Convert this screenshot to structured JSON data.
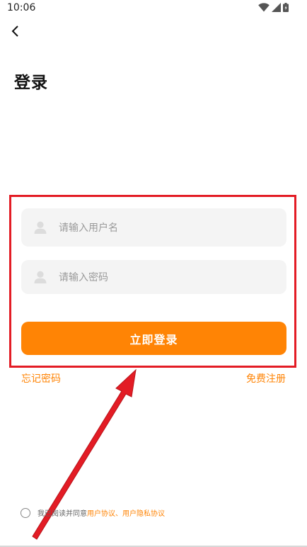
{
  "status_bar": {
    "time": "10:06"
  },
  "header": {
    "title": "登录"
  },
  "form": {
    "username_placeholder": "请输入用户名",
    "password_placeholder": "请输入密码",
    "login_button": "立即登录"
  },
  "links": {
    "forgot_password": "忘记密码",
    "register": "免费注册"
  },
  "agreement": {
    "prefix": "我已阅读并同意",
    "user_agreement": "用户协议",
    "separator": "、",
    "privacy_agreement": "用户隐私协议"
  },
  "colors": {
    "accent": "#ff8405",
    "highlight": "#e31c25",
    "field_bg": "#f4f4f4"
  },
  "icons": [
    "wifi-icon",
    "signal-icon",
    "battery-icon",
    "back-arrow-icon",
    "user-icon"
  ]
}
